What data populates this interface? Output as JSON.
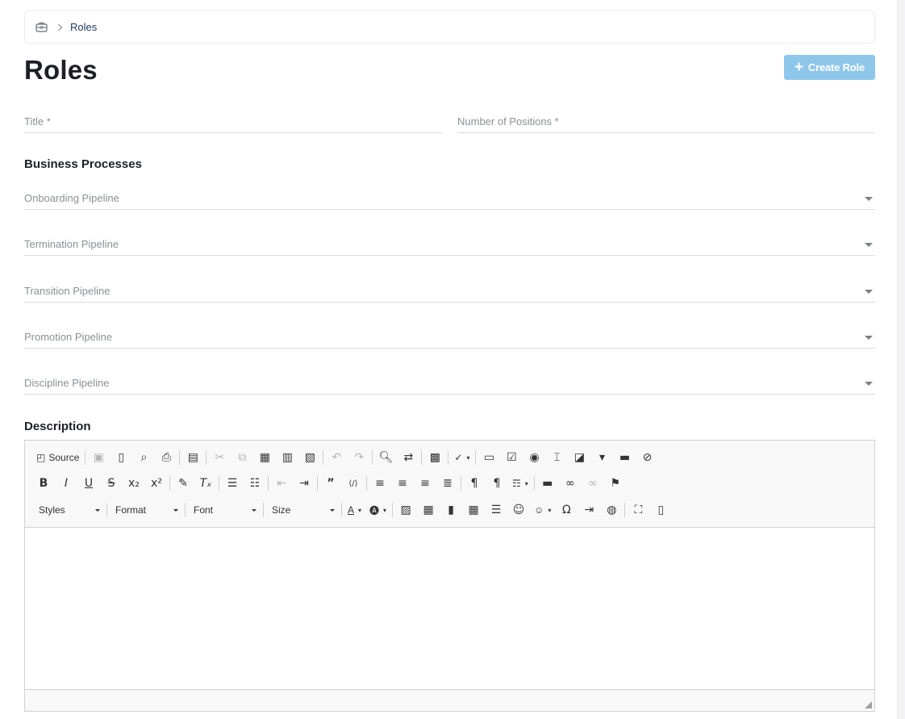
{
  "breadcrumb": {
    "home_icon": "briefcase-icon",
    "separator_icon": "chevron-right-icon",
    "current": "Roles"
  },
  "page": {
    "title": "Roles"
  },
  "actions": {
    "create_label": "Create Role",
    "create_icon": "plus-icon",
    "create_color": "#8ec7ea"
  },
  "form": {
    "title_placeholder": "Title *",
    "positions_placeholder": "Number of Positions *",
    "business_processes_heading": "Business Processes",
    "pipelines": [
      "Onboarding Pipeline",
      "Termination Pipeline",
      "Transition Pipeline",
      "Promotion Pipeline",
      "Discipline Pipeline"
    ],
    "description_heading": "Description"
  },
  "editor": {
    "source_label": "Source",
    "styles_label": "Styles",
    "format_label": "Format",
    "font_label": "Font",
    "size_label": "Size"
  }
}
